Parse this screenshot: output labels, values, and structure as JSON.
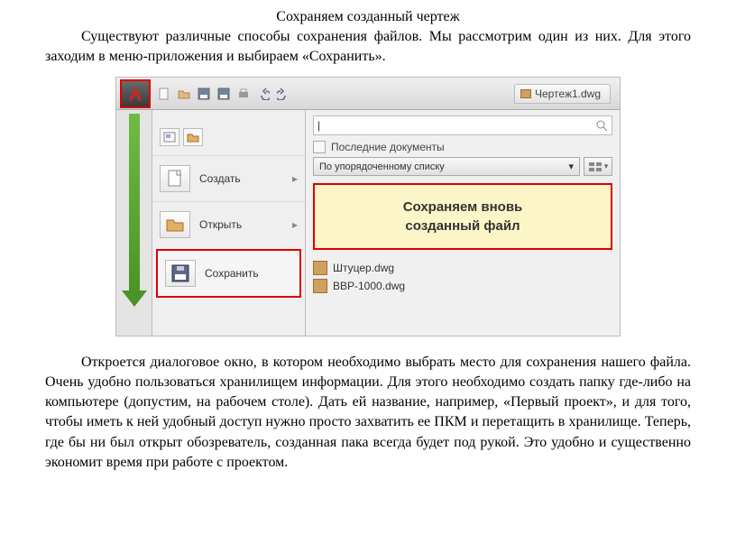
{
  "title": "Сохраняем созданный чертеж",
  "intro": "Существуют различные способы сохранения файлов. Мы рассмотрим один из них. Для этого заходим в меню-приложения и выбираем «Сохранить».",
  "tab_label": "Чертеж1.dwg",
  "menu": {
    "create": "Создать",
    "open": "Открыть",
    "save": "Сохранить"
  },
  "recent_header": "Последние документы",
  "sort_label": "По упорядоченному списку",
  "callout_line1": "Сохраняем вновь",
  "callout_line2": "созданный файл",
  "files": {
    "f1": "Штуцер.dwg",
    "f2": "BBP-1000.dwg"
  },
  "outro": "Откроется диалоговое окно, в котором необходимо выбрать место для сохранения нашего файла. Очень удобно пользоваться хранилищем информации. Для этого необходимо создать папку где-либо на компьютере (допустим, на рабочем столе). Дать ей название, например, «Первый проект», и для того, чтобы иметь к ней удобный доступ нужно просто захватить ее ПКМ и перетащить в хранилище. Теперь, где бы ни был открыт обозреватель, созданная пака всегда будет под рукой. Это удобно и существенно экономит время при работе с проектом."
}
